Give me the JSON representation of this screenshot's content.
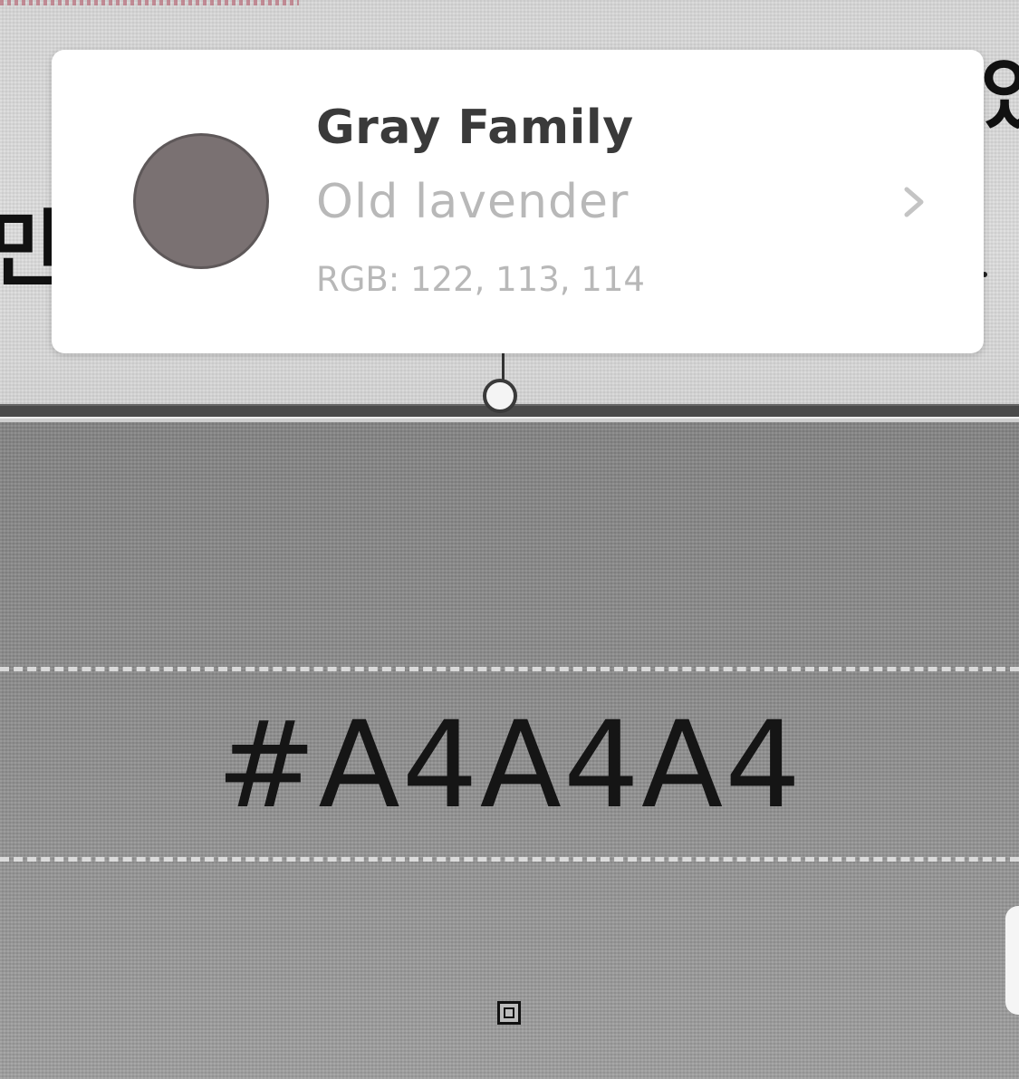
{
  "card": {
    "family_title": "Gray Family",
    "color_name": "Old lavender",
    "rgb_text": "RGB: 122, 113, 114",
    "swatch_color": "#7A7172",
    "chevron_icon": "chevron-right-icon"
  },
  "swatch": {
    "hex_label": "#A4A4A4"
  },
  "background": {
    "left_glyph": "만",
    "right_glyph": "있"
  },
  "colors": {
    "card_title": "#3A3A3A",
    "card_secondary_text": "#B8B8B8",
    "swatch_area": "#8D8D8D"
  }
}
